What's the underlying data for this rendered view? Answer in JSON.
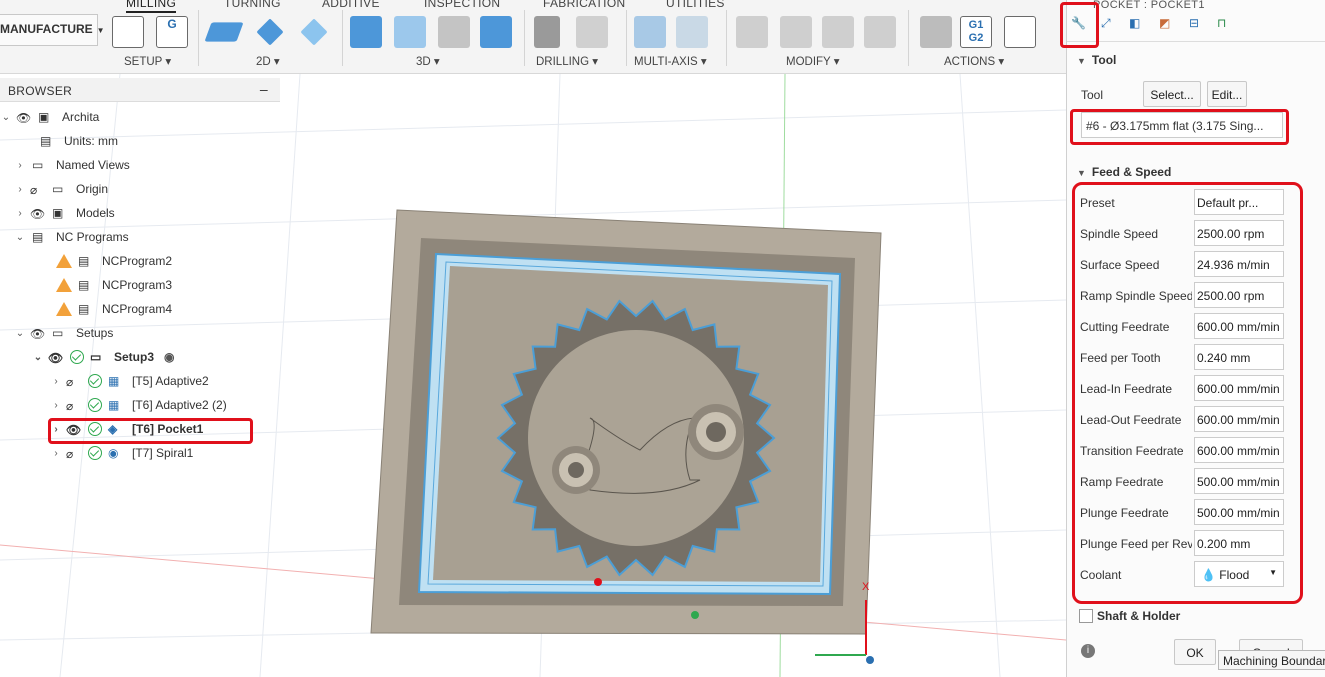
{
  "toolbar": {
    "tabs": [
      "MILLING",
      "TURNING",
      "ADDITIVE",
      "INSPECTION",
      "FABRICATION",
      "UTILITIES"
    ],
    "workspace": "MANUFACTURE",
    "groups": {
      "setup": "SETUP",
      "g2d": "2D",
      "g3d": "3D",
      "drilling": "DRILLING",
      "multiaxis": "MULTI-AXIS",
      "modify": "MODIFY",
      "actions": "ACTIONS"
    },
    "g1g2_top": "G1",
    "g1g2_bottom": "G2",
    "g_label": "G"
  },
  "browser": {
    "title": "BROWSER",
    "items": [
      {
        "label": "Archita"
      },
      {
        "label": "Units: mm"
      },
      {
        "label": "Named Views"
      },
      {
        "label": "Origin"
      },
      {
        "label": "Models"
      },
      {
        "label": "NC Programs"
      },
      {
        "label": "NCProgram2"
      },
      {
        "label": "NCProgram3"
      },
      {
        "label": "NCProgram4"
      },
      {
        "label": "Setups"
      },
      {
        "label": "Setup3"
      },
      {
        "label": "[T5] Adaptive2"
      },
      {
        "label": "[T6] Adaptive2 (2)"
      },
      {
        "label": "[T6] Pocket1"
      },
      {
        "label": "[T7] Spiral1"
      }
    ]
  },
  "panel": {
    "title": "POCKET : POCKET1",
    "tool_section": "Tool",
    "tool_label": "Tool",
    "select_button": "Select...",
    "edit_button": "Edit...",
    "tool_value": "#6 - Ø3.175mm flat (3.175 Sing...",
    "feed_section": "Feed & Speed",
    "rows": [
      {
        "label": "Preset",
        "value": "Default pr..."
      },
      {
        "label": "Spindle Speed",
        "value": "2500.00 rpm"
      },
      {
        "label": "Surface Speed",
        "value": "24.936 m/min"
      },
      {
        "label": "Ramp Spindle Speed",
        "value": "2500.00 rpm"
      },
      {
        "label": "Cutting Feedrate",
        "value": "600.00 mm/min"
      },
      {
        "label": "Feed per Tooth",
        "value": "0.240 mm"
      },
      {
        "label": "Lead-In Feedrate",
        "value": "600.00 mm/min"
      },
      {
        "label": "Lead-Out Feedrate",
        "value": "600.00 mm/min"
      },
      {
        "label": "Transition Feedrate",
        "value": "600.00 mm/min"
      },
      {
        "label": "Ramp Feedrate",
        "value": "500.00 mm/min"
      },
      {
        "label": "Plunge Feedrate",
        "value": "500.00 mm/min"
      },
      {
        "label": "Plunge Feed per Revolution",
        "value": "0.200 mm"
      },
      {
        "label": "Coolant",
        "value": "Flood"
      }
    ],
    "shaft_section": "Shaft & Holder",
    "ok_button": "OK",
    "cancel_button": "Cancel"
  },
  "tooltip": "Machining Boundary",
  "viewport": {
    "axis_x": "X"
  },
  "colors": {
    "highlight": "#e0101b",
    "accent": "#2a6fb0",
    "stock": "#b3aa9c"
  }
}
